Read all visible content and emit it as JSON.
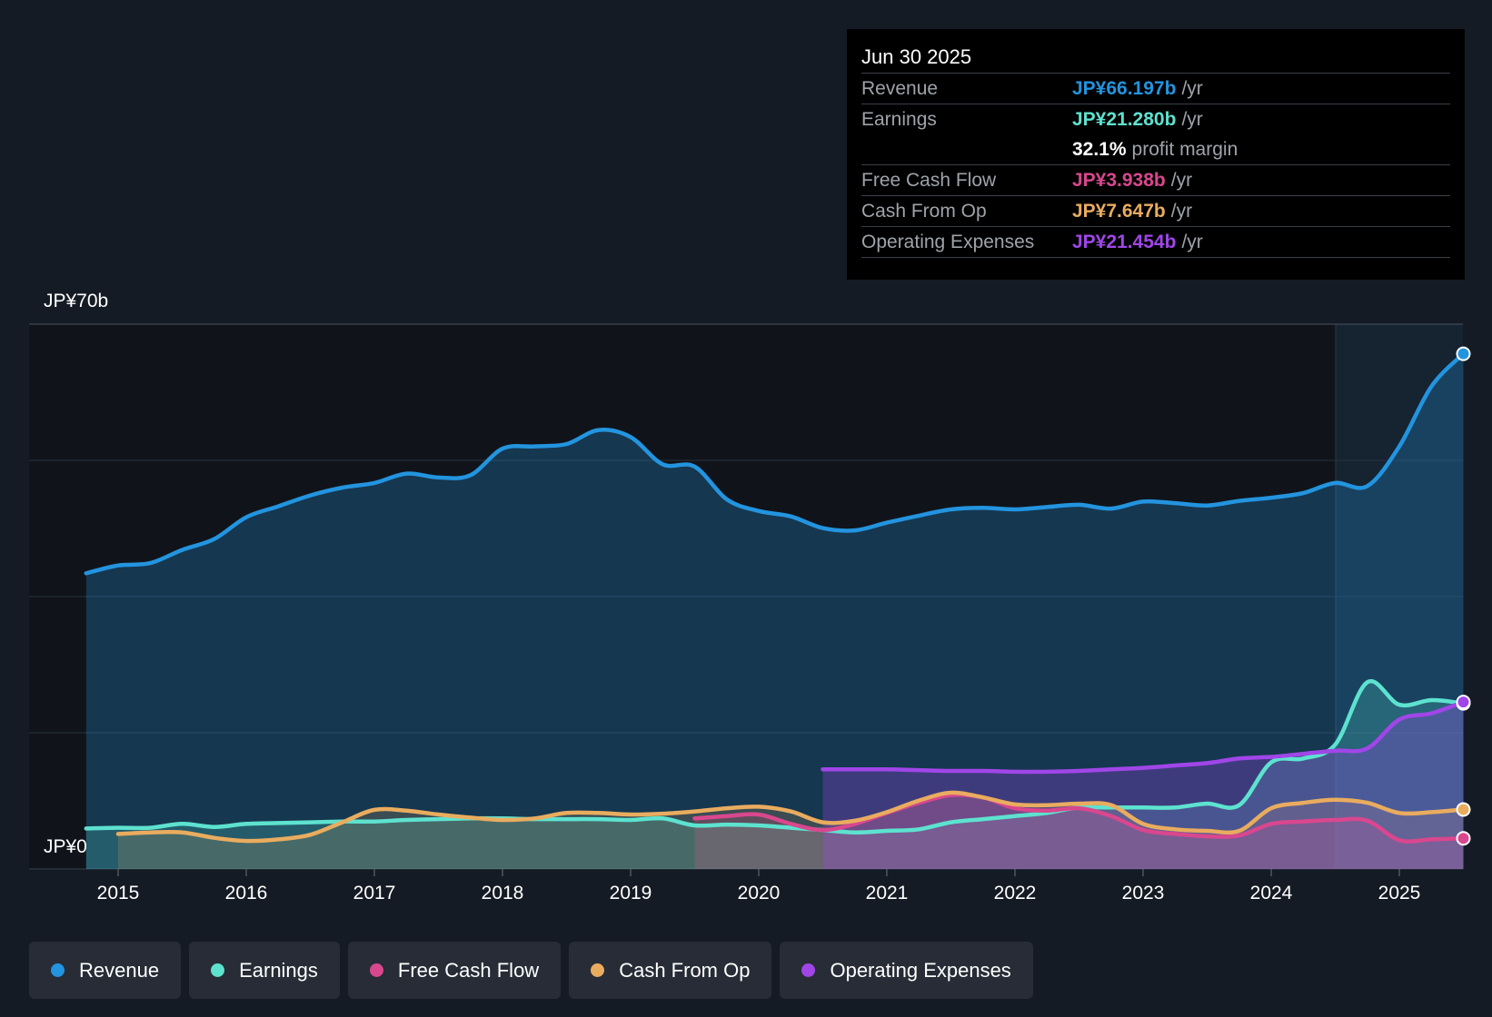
{
  "chart_data": {
    "type": "area",
    "y_top_label": "JP¥70b",
    "y_bottom_label": "JP¥0",
    "ylim": [
      0,
      70
    ],
    "x_ticks": [
      "2015",
      "2016",
      "2017",
      "2018",
      "2019",
      "2020",
      "2021",
      "2022",
      "2023",
      "2024",
      "2025"
    ],
    "grid": true,
    "series": [
      {
        "name": "Revenue",
        "color": "#2394df",
        "x": [
          2014.75,
          2015.0,
          2015.25,
          2015.5,
          2015.75,
          2016.0,
          2016.25,
          2016.5,
          2016.75,
          2017.0,
          2017.25,
          2017.5,
          2017.75,
          2018.0,
          2018.25,
          2018.5,
          2018.75,
          2019.0,
          2019.25,
          2019.5,
          2019.75,
          2020.0,
          2020.25,
          2020.5,
          2020.75,
          2021.0,
          2021.25,
          2021.5,
          2021.75,
          2022.0,
          2022.25,
          2022.5,
          2022.75,
          2023.0,
          2023.25,
          2023.5,
          2023.75,
          2024.0,
          2024.25,
          2024.5,
          2024.75,
          2025.0,
          2025.25,
          2025.5
        ],
        "values": [
          38.0,
          39.0,
          39.3,
          41.0,
          42.4,
          45.2,
          46.6,
          48.0,
          49.0,
          49.6,
          50.8,
          50.3,
          50.6,
          54.0,
          54.3,
          54.6,
          56.4,
          55.5,
          52.0,
          51.7,
          47.5,
          46.0,
          45.3,
          43.8,
          43.5,
          44.5,
          45.4,
          46.2,
          46.4,
          46.2,
          46.5,
          46.8,
          46.3,
          47.2,
          47.0,
          46.7,
          47.3,
          47.7,
          48.3,
          49.6,
          49.2,
          54.3,
          62.0,
          66.197
        ]
      },
      {
        "name": "Earnings",
        "color": "#5de2cf",
        "x": [
          2014.75,
          2015.0,
          2015.25,
          2015.5,
          2015.75,
          2016.0,
          2016.25,
          2016.5,
          2016.75,
          2017.0,
          2017.25,
          2017.5,
          2017.75,
          2018.0,
          2018.25,
          2018.5,
          2018.75,
          2019.0,
          2019.25,
          2019.5,
          2019.75,
          2020.0,
          2020.25,
          2020.5,
          2020.75,
          2021.0,
          2021.25,
          2021.5,
          2021.75,
          2022.0,
          2022.25,
          2022.5,
          2022.75,
          2023.0,
          2023.25,
          2023.5,
          2023.75,
          2024.0,
          2024.25,
          2024.5,
          2024.75,
          2025.0,
          2025.25,
          2025.5
        ],
        "values": [
          5.2,
          5.3,
          5.3,
          5.8,
          5.4,
          5.8,
          5.9,
          6.0,
          6.1,
          6.1,
          6.3,
          6.4,
          6.5,
          6.5,
          6.4,
          6.4,
          6.4,
          6.3,
          6.5,
          5.6,
          5.7,
          5.6,
          5.3,
          5.0,
          4.7,
          4.9,
          5.1,
          6.0,
          6.4,
          6.8,
          7.2,
          7.9,
          7.9,
          7.9,
          7.9,
          8.4,
          8.2,
          13.7,
          14.2,
          16.0,
          24.0,
          21.1,
          21.7,
          21.28
        ]
      },
      {
        "name": "Free Cash Flow",
        "color": "#d9478e",
        "x": [
          2019.5,
          2019.75,
          2020.0,
          2020.25,
          2020.5,
          2020.75,
          2021.0,
          2021.25,
          2021.5,
          2021.75,
          2022.0,
          2022.25,
          2022.5,
          2022.75,
          2023.0,
          2023.25,
          2023.5,
          2023.75,
          2024.0,
          2024.25,
          2024.5,
          2024.75,
          2025.0,
          2025.25,
          2025.5
        ],
        "values": [
          6.5,
          6.8,
          7.0,
          5.8,
          5.0,
          5.8,
          7.2,
          8.5,
          9.5,
          9.2,
          7.8,
          7.5,
          7.8,
          6.8,
          5.0,
          4.5,
          4.2,
          4.3,
          5.8,
          6.1,
          6.3,
          6.2,
          3.7,
          3.8,
          3.938
        ]
      },
      {
        "name": "Cash From Op",
        "color": "#e9ac5f",
        "x": [
          2015.0,
          2015.25,
          2015.5,
          2015.75,
          2016.0,
          2016.25,
          2016.5,
          2016.75,
          2017.0,
          2017.25,
          2017.5,
          2017.75,
          2018.0,
          2018.25,
          2018.5,
          2018.75,
          2019.0,
          2019.25,
          2019.5,
          2019.75,
          2020.0,
          2020.25,
          2020.5,
          2020.75,
          2021.0,
          2021.25,
          2021.5,
          2021.75,
          2022.0,
          2022.25,
          2022.5,
          2022.75,
          2023.0,
          2023.25,
          2023.5,
          2023.75,
          2024.0,
          2024.25,
          2024.5,
          2024.75,
          2025.0,
          2025.25,
          2025.5
        ],
        "values": [
          4.5,
          4.7,
          4.7,
          4.0,
          3.6,
          3.8,
          4.4,
          6.0,
          7.6,
          7.5,
          7.0,
          6.6,
          6.3,
          6.5,
          7.2,
          7.2,
          7.0,
          7.1,
          7.4,
          7.8,
          8.0,
          7.4,
          6.0,
          6.2,
          7.3,
          8.8,
          9.8,
          9.2,
          8.3,
          8.2,
          8.4,
          8.2,
          5.8,
          5.1,
          4.9,
          4.9,
          7.8,
          8.5,
          8.9,
          8.5,
          7.2,
          7.3,
          7.647
        ]
      },
      {
        "name": "Operating Expenses",
        "color": "#a046e8",
        "x": [
          2020.5,
          2020.75,
          2021.0,
          2021.25,
          2021.5,
          2021.75,
          2022.0,
          2022.25,
          2022.5,
          2022.75,
          2023.0,
          2023.25,
          2023.5,
          2023.75,
          2024.0,
          2024.25,
          2024.5,
          2024.75,
          2025.0,
          2025.25,
          2025.5
        ],
        "values": [
          12.8,
          12.8,
          12.8,
          12.7,
          12.6,
          12.6,
          12.5,
          12.5,
          12.6,
          12.8,
          13.0,
          13.3,
          13.6,
          14.2,
          14.4,
          14.8,
          15.2,
          15.5,
          19.2,
          20.0,
          21.454
        ]
      }
    ]
  },
  "tooltip": {
    "date": "Jun 30 2025",
    "rows": [
      {
        "label": "Revenue",
        "value": "JP¥66.197b",
        "unit": "/yr",
        "color": "#2394df"
      },
      {
        "label": "Earnings",
        "value": "JP¥21.280b",
        "unit": "/yr",
        "color": "#5de2cf"
      },
      {
        "label": "",
        "value": "32.1%",
        "unit": "profit margin",
        "color": "#ffffff"
      },
      {
        "label": "Free Cash Flow",
        "value": "JP¥3.938b",
        "unit": "/yr",
        "color": "#d9478e"
      },
      {
        "label": "Cash From Op",
        "value": "JP¥7.647b",
        "unit": "/yr",
        "color": "#e9ac5f"
      },
      {
        "label": "Operating Expenses",
        "value": "JP¥21.454b",
        "unit": "/yr",
        "color": "#a046e8"
      }
    ]
  },
  "legend": [
    {
      "label": "Revenue",
      "color": "#2394df"
    },
    {
      "label": "Earnings",
      "color": "#5de2cf"
    },
    {
      "label": "Free Cash Flow",
      "color": "#d9478e"
    },
    {
      "label": "Cash From Op",
      "color": "#e9ac5f"
    },
    {
      "label": "Operating Expenses",
      "color": "#a046e8"
    }
  ]
}
